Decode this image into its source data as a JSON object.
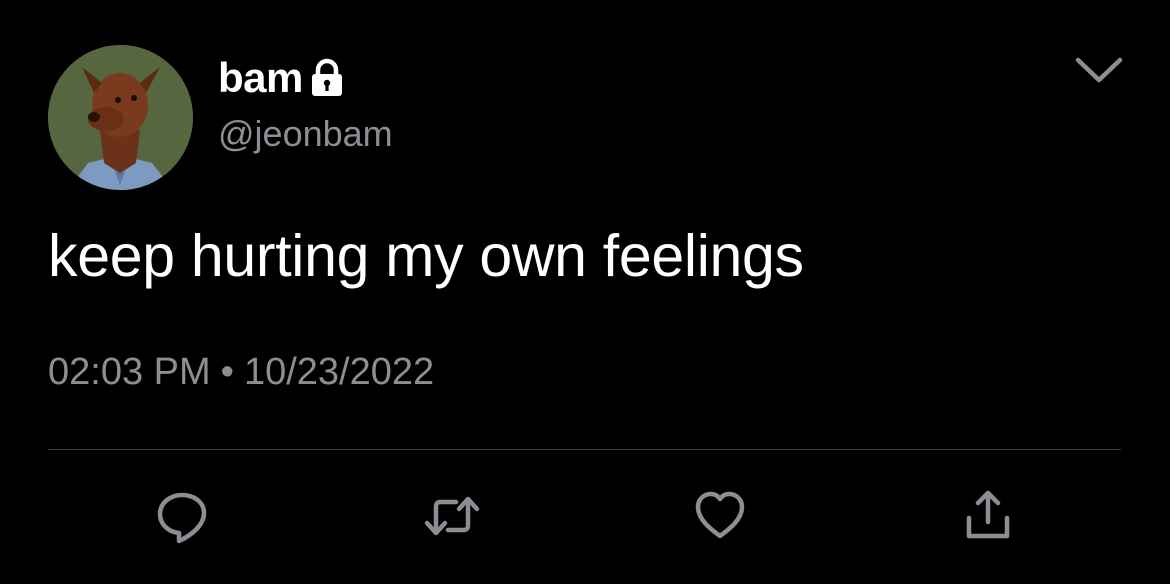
{
  "tweet": {
    "display_name": "bam",
    "handle": "@jeonbam",
    "text": "keep hurting my own feelings",
    "time": "02:03 PM",
    "separator": "•",
    "date": "10/23/2022",
    "protected_icon": "lock-icon",
    "avatar_icon": "dog-avatar"
  },
  "actions": [
    {
      "name": "reply",
      "icon": "comment-icon"
    },
    {
      "name": "retweet",
      "icon": "retweet-icon"
    },
    {
      "name": "like",
      "icon": "heart-icon"
    },
    {
      "name": "share",
      "icon": "share-icon"
    }
  ],
  "menu": {
    "icon": "chevron-down-icon"
  },
  "colors": {
    "background": "#000000",
    "primary_text": "#ffffff",
    "secondary_text": "#8b8f94",
    "divider": "#3a3d40"
  }
}
